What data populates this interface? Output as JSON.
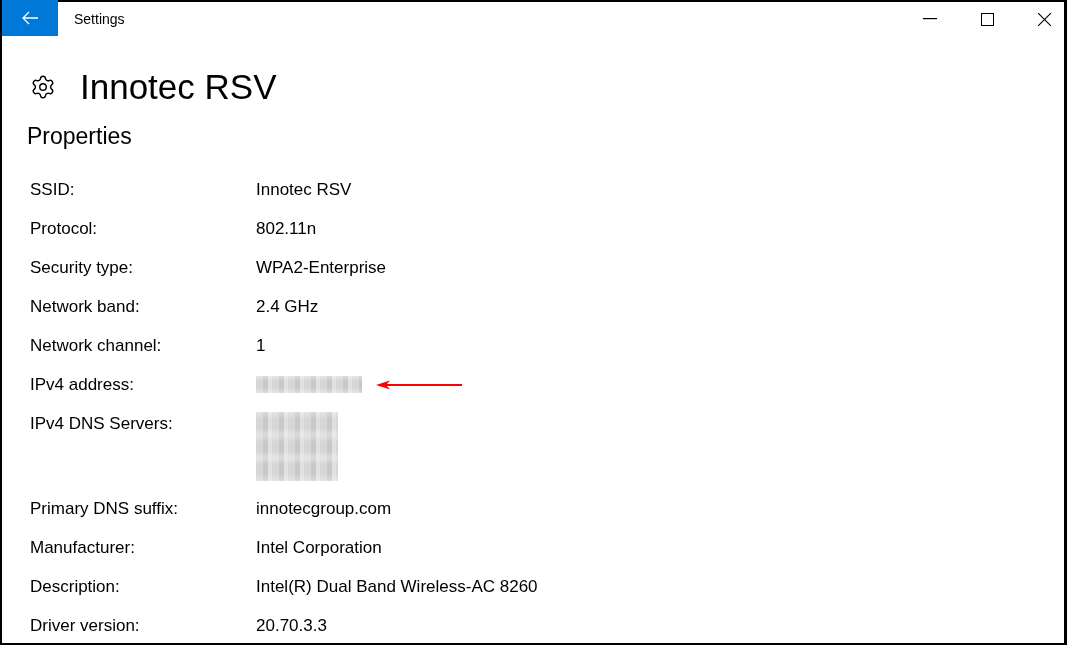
{
  "window": {
    "title": "Settings"
  },
  "header": {
    "title": "Innotec RSV"
  },
  "section": {
    "title": "Properties"
  },
  "properties": [
    {
      "label": "SSID:",
      "values": [
        {
          "kind": "text",
          "text": "Innotec RSV"
        }
      ],
      "marked": false
    },
    {
      "label": "Protocol:",
      "values": [
        {
          "kind": "text",
          "text": "802.11n"
        }
      ],
      "marked": false
    },
    {
      "label": "Security type:",
      "values": [
        {
          "kind": "text",
          "text": "WPA2-Enterprise"
        }
      ],
      "marked": false
    },
    {
      "label": "Network band:",
      "values": [
        {
          "kind": "text",
          "text": "2.4 GHz"
        }
      ],
      "marked": false
    },
    {
      "label": "Network channel:",
      "values": [
        {
          "kind": "text",
          "text": "1"
        }
      ],
      "marked": false
    },
    {
      "label": "IPv4 address:",
      "values": [
        {
          "kind": "redacted"
        }
      ],
      "marked": true
    },
    {
      "label": "IPv4 DNS Servers:",
      "values": [
        {
          "kind": "redacted"
        },
        {
          "kind": "redacted"
        },
        {
          "kind": "redacted"
        }
      ],
      "marked": false
    },
    {
      "label": "Primary DNS suffix:",
      "values": [
        {
          "kind": "text",
          "text": "innotecgroup.com"
        }
      ],
      "marked": false
    },
    {
      "label": "Manufacturer:",
      "values": [
        {
          "kind": "text",
          "text": "Intel Corporation"
        }
      ],
      "marked": false
    },
    {
      "label": "Description:",
      "values": [
        {
          "kind": "text",
          "text": "Intel(R) Dual Band Wireless-AC 8260"
        }
      ],
      "marked": false
    },
    {
      "label": "Driver version:",
      "values": [
        {
          "kind": "text",
          "text": "20.70.3.3"
        }
      ],
      "marked": false
    }
  ]
}
